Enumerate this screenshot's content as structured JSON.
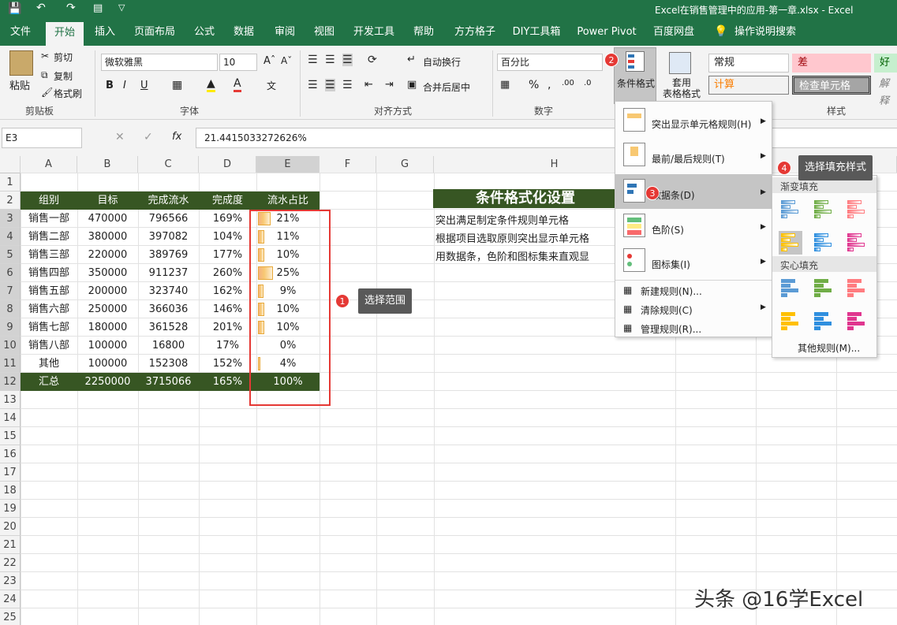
{
  "titlebar": {
    "doc_title": "Excel在销售管理中的应用-第一章.xlsx  -  Excel"
  },
  "menu_tabs": [
    "文件",
    "开始",
    "插入",
    "页面布局",
    "公式",
    "数据",
    "审阅",
    "视图",
    "开发工具",
    "帮助",
    "方方格子",
    "DIY工具箱",
    "Power Pivot",
    "百度网盘",
    "操作说明搜索"
  ],
  "ribbon": {
    "clipboard": {
      "paste": "粘贴",
      "cut": "剪切",
      "copy": "复制",
      "format_painter": "格式刷",
      "label": "剪贴板"
    },
    "font": {
      "name": "微软雅黑",
      "size": "10",
      "bold": "B",
      "italic": "I",
      "underline": "U",
      "label": "字体"
    },
    "alignment": {
      "wrap": "自动换行",
      "merge": "合并后居中",
      "label": "对齐方式"
    },
    "number": {
      "format": "百分比",
      "label": "数字"
    },
    "cond_format": "条件格式",
    "table_format": "套用\n表格格式",
    "styles": {
      "normal": "常规",
      "bad": "差",
      "good": "好",
      "calc": "计算",
      "check": "检查单元格",
      "explain": "解释",
      "label": "样式"
    }
  },
  "formula_bar": {
    "name_box": "E3",
    "fx": "fx",
    "value": "21.4415033272626%"
  },
  "columns": [
    "A",
    "B",
    "C",
    "D",
    "E",
    "F",
    "G",
    "H"
  ],
  "rows": [
    "1",
    "2",
    "3",
    "4",
    "5",
    "6",
    "7",
    "8",
    "9",
    "10",
    "11",
    "12",
    "13",
    "14",
    "15",
    "16",
    "17",
    "18",
    "19",
    "20",
    "21",
    "22",
    "23",
    "24",
    "25"
  ],
  "table": {
    "headers": [
      "组别",
      "目标",
      "完成流水",
      "完成度",
      "流水占比"
    ],
    "rows": [
      [
        "销售一部",
        "470000",
        "796566",
        "169%",
        "21%"
      ],
      [
        "销售二部",
        "380000",
        "397082",
        "104%",
        "11%"
      ],
      [
        "销售三部",
        "220000",
        "389769",
        "177%",
        "10%"
      ],
      [
        "销售四部",
        "350000",
        "911237",
        "260%",
        "25%"
      ],
      [
        "销售五部",
        "200000",
        "323740",
        "162%",
        "9%"
      ],
      [
        "销售六部",
        "250000",
        "366036",
        "146%",
        "10%"
      ],
      [
        "销售七部",
        "180000",
        "361528",
        "201%",
        "10%"
      ],
      [
        "销售八部",
        "100000",
        "16800",
        "17%",
        "0%"
      ],
      [
        "其他",
        "100000",
        "152308",
        "152%",
        "4%"
      ],
      [
        "汇总",
        "2250000",
        "3715066",
        "165%",
        "100%"
      ]
    ],
    "share_values": [
      0.21,
      0.11,
      0.1,
      0.25,
      0.09,
      0.1,
      0.1,
      0.0,
      0.04,
      1.0
    ]
  },
  "notes": {
    "title": "条件格式化设置",
    "lines": [
      "突出满足制定条件规则单元格",
      "根据项目选取原则突出显示单元格",
      "用数据条，色阶和图标集来直观显"
    ]
  },
  "cf_menu": {
    "items": [
      "突出显示单元格规则(H)",
      "最前/最后规则(T)",
      "数据条(D)",
      "色阶(S)",
      "图标集(I)"
    ],
    "small_items": [
      "新建规则(N)...",
      "清除规则(C)",
      "管理规则(R)..."
    ]
  },
  "databar_menu": {
    "gradient_label": "渐变填充",
    "solid_label": "实心填充",
    "more": "其他规则(M)...",
    "colors": [
      "#5b9bd5",
      "#70ad47",
      "#ff7c80",
      "#ffc000",
      "#2f8fdf",
      "#e0368f"
    ]
  },
  "callouts": {
    "c1": "选择范围",
    "c4": "选择填充样式"
  },
  "badges": [
    "1",
    "2",
    "3",
    "4"
  ],
  "watermark": "头条 @16学Excel"
}
